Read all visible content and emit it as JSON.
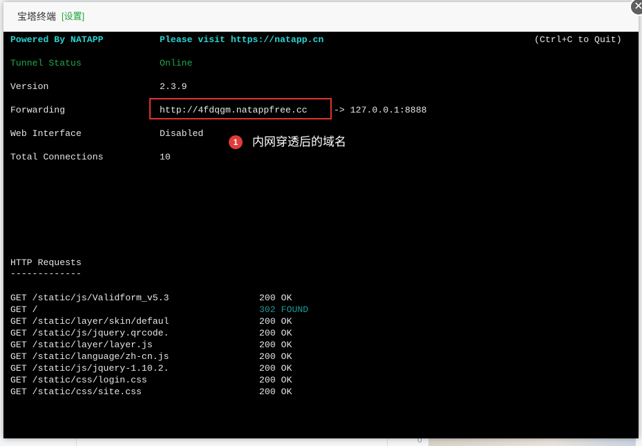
{
  "modal": {
    "title": "宝塔终端",
    "settings_link": "[设置]",
    "close_icon": "close-x-icon"
  },
  "terminal": {
    "header": {
      "powered": "Powered By NATAPP",
      "visit": "Please visit https://natapp.cn",
      "quit": "(Ctrl+C to Quit)"
    },
    "rows": [
      {
        "label": "Tunnel Status",
        "value": "Online"
      },
      {
        "label": "Version",
        "value": "2.3.9"
      },
      {
        "label": "Forwarding",
        "value": "http://4fdqgm.natappfree.cc",
        "suffix": "-> 127.0.0.1:8888"
      },
      {
        "label": "Web Interface",
        "value": "Disabled"
      },
      {
        "label": "Total Connections",
        "value": "10"
      }
    ],
    "annotation": {
      "number": "1",
      "text": "内网穿透后的域名"
    },
    "http_title": "HTTP Requests",
    "http_rule": "-------------",
    "requests": [
      {
        "path": "GET /static/js/Validform_v5.3",
        "status": "200 OK"
      },
      {
        "path": "GET /",
        "status": "302 FOUND"
      },
      {
        "path": "GET /static/layer/skin/defaul",
        "status": "200 OK"
      },
      {
        "path": "GET /static/js/jquery.qrcode.",
        "status": "200 OK"
      },
      {
        "path": "GET /static/layer/layer.js",
        "status": "200 OK"
      },
      {
        "path": "GET /static/language/zh-cn.js",
        "status": "200 OK"
      },
      {
        "path": "GET /static/js/jquery-1.10.2.",
        "status": "200 OK"
      },
      {
        "path": "GET /static/css/login.css",
        "status": "200 OK"
      },
      {
        "path": "GET /static/css/site.css",
        "status": "200 OK"
      }
    ]
  },
  "background": {
    "axis_tick": "0"
  },
  "colors": {
    "terminal_bg": "#000000",
    "header_cyan": "#29d3d3",
    "online_green": "#1faa47",
    "found_teal": "#1d9a99",
    "highlight_red": "#e5322d",
    "settings_green": "#20a53a"
  }
}
